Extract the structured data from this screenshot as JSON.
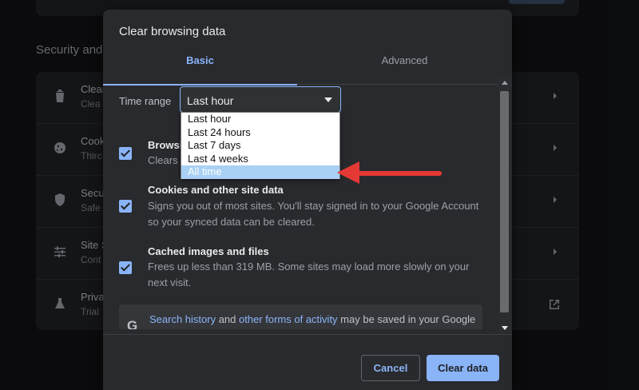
{
  "background": {
    "section_title": "Security and",
    "rows": [
      {
        "icon": "trash-icon",
        "title": "Clear",
        "subtitle": "Clea"
      },
      {
        "icon": "cookie-icon",
        "title": "Cook",
        "subtitle": "Thirc"
      },
      {
        "icon": "shield-icon",
        "title": "Secu",
        "subtitle": "Safe"
      },
      {
        "icon": "sliders-icon",
        "title": "Site S",
        "subtitle": "Cont"
      },
      {
        "icon": "flask-icon",
        "title": "Priva",
        "subtitle": "Trial"
      }
    ]
  },
  "dialog": {
    "title": "Clear browsing data",
    "tabs": [
      "Basic",
      "Advanced"
    ],
    "active_tab": "Basic",
    "time_range": {
      "label": "Time range",
      "value": "Last hour",
      "options": [
        "Last hour",
        "Last 24 hours",
        "Last 7 days",
        "Last 4 weeks",
        "All time"
      ],
      "highlighted": "All time"
    },
    "options": [
      {
        "title": "Browsi",
        "desc": "Clears",
        "checked": true
      },
      {
        "title": "Cookies and other site data",
        "desc": "Signs you out of most sites. You'll stay signed in to your Google Account so your synced data can be cleared.",
        "checked": true
      },
      {
        "title": "Cached images and files",
        "desc": "Frees up less than 319 MB. Some sites may load more slowly on your next visit.",
        "checked": true
      }
    ],
    "info": {
      "link1": "Search history",
      "text1": " and ",
      "link2": "other forms of activity",
      "text2": " may be saved in your Google Account when you're signed in. You can delete them anytime."
    },
    "buttons": {
      "cancel": "Cancel",
      "clear": "Clear data"
    }
  },
  "colors": {
    "accent": "#8ab4f8",
    "dialog_bg": "#292a2d",
    "annotation": "#e53935",
    "highlight": "#a9d0f5"
  }
}
